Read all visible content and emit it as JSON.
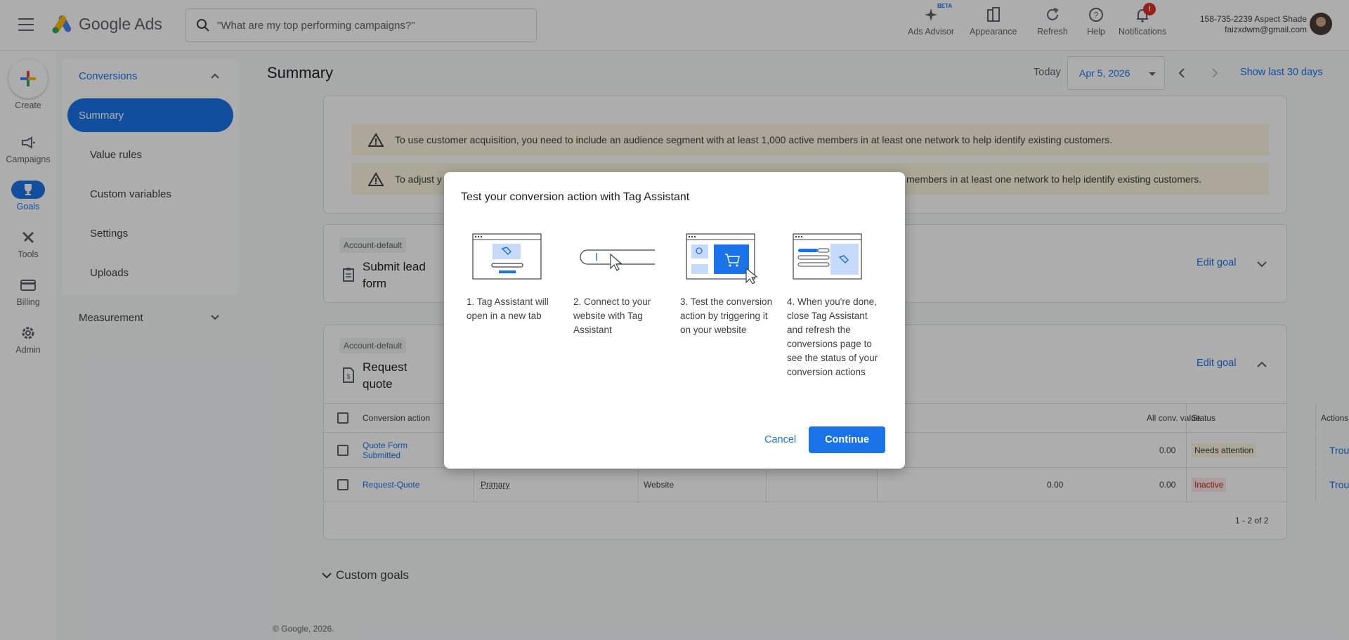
{
  "topbar": {
    "app_name": "Google Ads",
    "search_placeholder": "\"What are my top performing campaigns?\"",
    "icons": [
      {
        "label": "Ads Advisor",
        "icon": "sparkle-icon",
        "beta": "BETA"
      },
      {
        "label": "Appearance",
        "icon": "appearance-icon"
      },
      {
        "label": "Refresh",
        "icon": "refresh-icon"
      },
      {
        "label": "Help",
        "icon": "help-icon"
      },
      {
        "label": "Notifications",
        "icon": "bell-icon",
        "badge": "!"
      }
    ],
    "account_line1": "158-735-2239 Aspect Shade",
    "account_line2": "faizxdwm@gmail.com"
  },
  "header": {
    "title": "Summary",
    "today_label": "Today",
    "date_value": "Apr 5, 2026",
    "show_last": "Show last 30 days"
  },
  "rail": {
    "create": "Create",
    "items": [
      {
        "label": "Campaigns",
        "icon": "megaphone-icon"
      },
      {
        "label": "Goals",
        "icon": "trophy-icon"
      },
      {
        "label": "Tools",
        "icon": "tools-icon"
      },
      {
        "label": "Billing",
        "icon": "card-icon"
      },
      {
        "label": "Admin",
        "icon": "gear-icon"
      }
    ]
  },
  "sidenav": {
    "section": "Conversions",
    "items": [
      "Summary",
      "Value rules",
      "Custom variables",
      "Settings",
      "Uploads"
    ],
    "measurement": "Measurement"
  },
  "main": {
    "warning1": "To use customer acquisition, you need to include an audience segment with at least 1,000 active members in at least one network to help identify existing customers.",
    "warning2_left": "To adjust y",
    "warning2_right": "members in at least one network to help identify existing customers.",
    "goal1": {
      "chip": "Account-default",
      "title": "Submit lead form",
      "edit": "Edit goal"
    },
    "goal2": {
      "chip": "Account-default",
      "title": "Request quote",
      "edit": "Edit goal"
    },
    "table": {
      "headers": {
        "action": "Conversion action",
        "all_conv_value": "All conv. value",
        "status": "Status",
        "actions": "Actions"
      },
      "rows": [
        {
          "name": "Quote Form Submitted",
          "optimization": "",
          "source": "",
          "conv_value": "",
          "all_conv_value": "0.00",
          "status": "Needs attention",
          "action": "Troubleshoot"
        },
        {
          "name": "Request-Quote",
          "optimization": "Primary",
          "source": "Website",
          "conv_value": "0.00",
          "all_conv_value": "0.00",
          "status": "Inactive",
          "action": "Troubleshoot"
        }
      ],
      "pager": "1 - 2 of 2"
    },
    "custom_goals": "Custom goals",
    "footer": "© Google, 2026."
  },
  "dialog": {
    "title": "Test your conversion action with Tag Assistant",
    "steps": [
      "1. Tag Assistant will open in a new tab",
      "2. Connect to your website with Tag Assistant",
      "3. Test the conversion action by triggering it on your website",
      "4. When you're done, close Tag Assistant and refresh the conversions page to see the status of your conversion actions"
    ],
    "cancel": "Cancel",
    "continue": "Continue"
  },
  "colors": {
    "primary": "#1a73e8",
    "warning_bg": "#fef7e0",
    "inactive": "#c5221f"
  }
}
